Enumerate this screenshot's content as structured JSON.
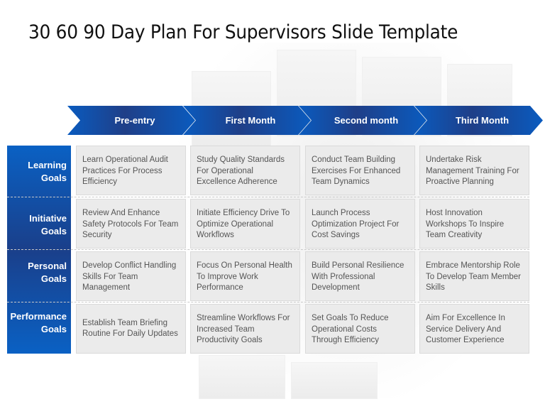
{
  "title": "30 60 90 Day Plan For Supervisors Slide Template",
  "colors": {
    "accent": "#0a5bbf",
    "accent_dark": "#1f3f88",
    "cell_bg": "#ebebeb",
    "cell_text": "#555555"
  },
  "phases": [
    "Pre-entry",
    "First Month",
    "Second month",
    "Third Month"
  ],
  "rows": [
    {
      "label_line1": "Learning",
      "label_line2": "Goals",
      "cells": [
        "Learn Operational Audit Practices For Process Efficiency",
        "Study Quality Standards For Operational Excellence Adherence",
        "Conduct Team Building Exercises For Enhanced Team Dynamics",
        "Undertake Risk Management Training For Proactive Planning"
      ]
    },
    {
      "label_line1": "Initiative",
      "label_line2": "Goals",
      "cells": [
        "Review And Enhance Safety Protocols For Team Security",
        "Initiate Efficiency Drive To Optimize Operational Workflows",
        "Launch Process Optimization Project For Cost Savings",
        "Host Innovation Workshops To Inspire Team Creativity"
      ]
    },
    {
      "label_line1": "Personal",
      "label_line2": "Goals",
      "cells": [
        "Develop Conflict Handling Skills For Team Management",
        "Focus On Personal Health To Improve Work Performance",
        "Build Personal Resilience With Professional Development",
        "Embrace Mentorship Role To Develop Team Member Skills"
      ]
    },
    {
      "label_line1": "Performance",
      "label_line2": "Goals",
      "cells": [
        "Establish Team Briefing Routine For Daily Updates",
        "Streamline Workflows For Increased Team Productivity Goals",
        "Set Goals To Reduce Operational Costs Through Efficiency",
        "Aim For Excellence In Service Delivery And Customer Experience"
      ]
    }
  ]
}
